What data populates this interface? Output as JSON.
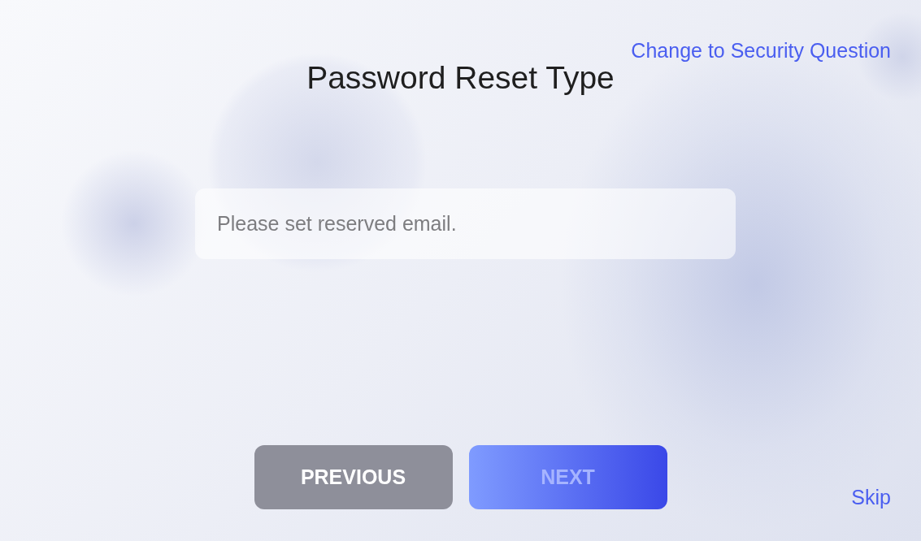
{
  "header": {
    "link": "Change to Security Question",
    "title": "Password Reset Type"
  },
  "email_field": {
    "placeholder": "Please set reserved email."
  },
  "buttons": [
    {
      "label": "PREVIOUS",
      "kind": "secondary",
      "disabled": false
    },
    {
      "label": "NEXT",
      "kind": "primary",
      "disabled": true
    }
  ],
  "skip": "Skip"
}
